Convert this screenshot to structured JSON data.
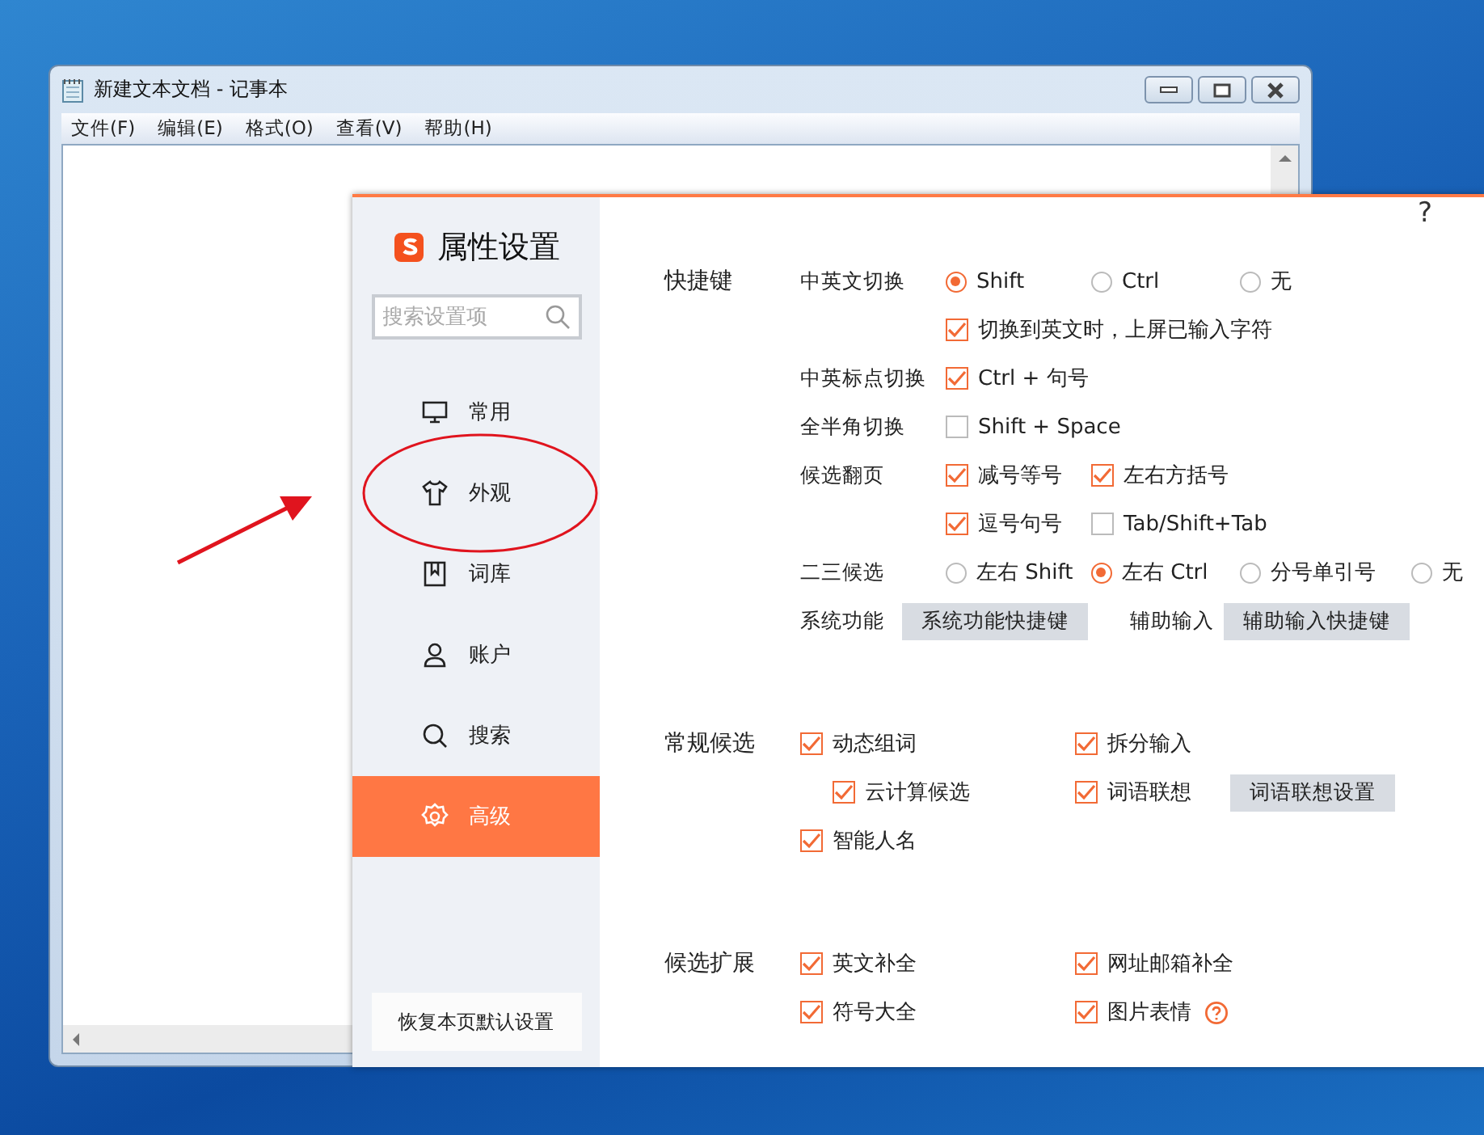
{
  "notepad": {
    "title": "新建文本文档 - 记事本",
    "menu": [
      "文件(F)",
      "编辑(E)",
      "格式(O)",
      "查看(V)",
      "帮助(H)"
    ]
  },
  "settings": {
    "title": "属性设置",
    "search": {
      "placeholder": "搜索设置项"
    },
    "nav": [
      {
        "label": "常用",
        "selected": false
      },
      {
        "label": "外观",
        "selected": false
      },
      {
        "label": "词库",
        "selected": false
      },
      {
        "label": "账户",
        "selected": false
      },
      {
        "label": "搜索",
        "selected": false
      },
      {
        "label": "高级",
        "selected": true
      }
    ],
    "reset_button": "恢复本页默认设置",
    "help": "?",
    "sections": [
      {
        "title": "快捷键",
        "kind": "grid",
        "rows": [
          {
            "label": "中英文切换",
            "items": [
              {
                "kind": "radio",
                "text": "Shift",
                "selected": true
              },
              {
                "kind": "radio",
                "text": "Ctrl",
                "selected": false
              },
              {
                "kind": "radio",
                "text": "无",
                "selected": false
              }
            ]
          },
          {
            "items": [
              {
                "kind": "checkbox",
                "text": "切换到英文时，上屏已输入字符",
                "checked": true
              }
            ]
          },
          {
            "label": "中英标点切换",
            "items": [
              {
                "kind": "checkbox",
                "text": "Ctrl + 句号",
                "checked": true
              }
            ]
          },
          {
            "label": "全半角切换",
            "items": [
              {
                "kind": "checkbox",
                "text": "Shift + Space",
                "checked": false
              }
            ]
          },
          {
            "label": "候选翻页",
            "items": [
              {
                "kind": "checkbox",
                "text": "减号等号",
                "checked": true
              },
              {
                "kind": "checkbox",
                "text": "左右方括号",
                "checked": true
              }
            ]
          },
          {
            "items": [
              {
                "kind": "checkbox",
                "text": "逗号句号",
                "checked": true
              },
              {
                "kind": "checkbox",
                "text": "Tab/Shift+Tab",
                "checked": false
              }
            ]
          },
          {
            "label": "二三候选",
            "items": [
              {
                "kind": "radio",
                "text": "左右 Shift",
                "selected": false
              },
              {
                "kind": "radio",
                "text": "左右 Ctrl",
                "selected": true
              },
              {
                "kind": "radio",
                "text": "分号单引号",
                "selected": false
              },
              {
                "kind": "radio",
                "text": "无",
                "selected": false
              }
            ]
          },
          {
            "label": "系统功能",
            "kind": "buttons",
            "items": [
              {
                "kind": "button",
                "text": "系统功能快捷键"
              },
              {
                "kind": "label",
                "text": "辅助输入"
              },
              {
                "kind": "button",
                "text": "辅助输入快捷键"
              }
            ]
          }
        ]
      },
      {
        "title": "常规候选",
        "kind": "pairs",
        "rows": [
          {
            "items": [
              {
                "kind": "checkbox",
                "text": "动态组词",
                "checked": true
              },
              {
                "kind": "checkbox",
                "text": "拆分输入",
                "checked": true
              }
            ]
          },
          {
            "items": [
              {
                "kind": "subcheckbox",
                "text": "云计算候选",
                "checked": true
              },
              {
                "kind": "checkbox",
                "text": "词语联想",
                "checked": true
              },
              {
                "kind": "button",
                "text": "词语联想设置"
              }
            ]
          },
          {
            "items": [
              {
                "kind": "checkbox",
                "text": "智能人名",
                "checked": true
              }
            ]
          }
        ]
      },
      {
        "title": "候选扩展",
        "kind": "pairs",
        "rows": [
          {
            "items": [
              {
                "kind": "checkbox",
                "text": "英文补全",
                "checked": true
              },
              {
                "kind": "checkbox",
                "text": "网址邮箱补全",
                "checked": true
              }
            ]
          },
          {
            "items": [
              {
                "kind": "checkbox",
                "text": "符号大全",
                "checked": true
              },
              {
                "kind": "checkbox",
                "text": "图片表情",
                "checked": true,
                "info": true
              }
            ]
          }
        ]
      }
    ]
  }
}
